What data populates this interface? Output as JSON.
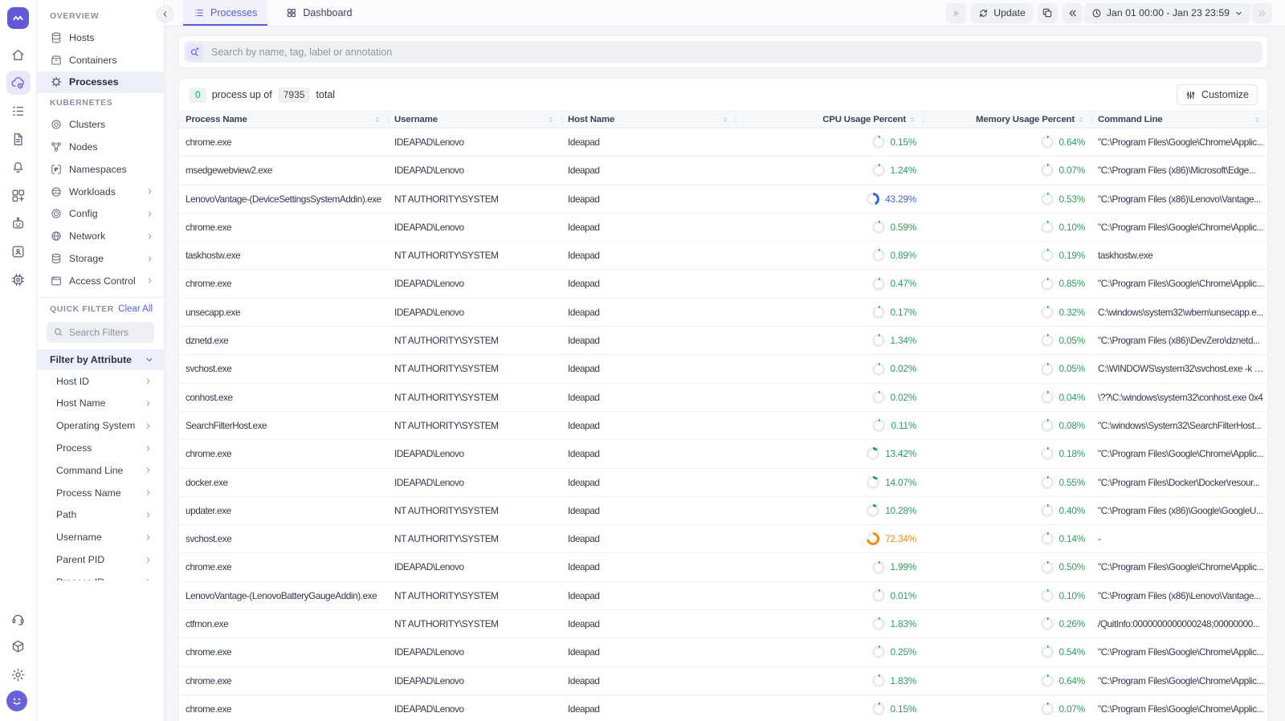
{
  "colors": {
    "green": "#26a35a",
    "blue": "#3e63dd",
    "orange": "#ef8e0d",
    "accent": "#5b5bd6",
    "track": "#e9ebee"
  },
  "rail": {
    "items": [
      "home",
      "infrastructure",
      "logs",
      "documents",
      "alerts",
      "dashboards",
      "bot",
      "rum",
      "integrations"
    ],
    "active": "infrastructure",
    "bottom": [
      "headset",
      "package",
      "gear"
    ],
    "avatar": "user-avatar"
  },
  "sidebar": {
    "sections": [
      {
        "title": "OVERVIEW",
        "items": [
          {
            "label": "Hosts",
            "icon": "hosts"
          },
          {
            "label": "Containers",
            "icon": "containers"
          },
          {
            "label": "Processes",
            "icon": "processes",
            "active": true
          }
        ]
      },
      {
        "title": "KUBERNETES",
        "items": [
          {
            "label": "Clusters",
            "icon": "clusters"
          },
          {
            "label": "Nodes",
            "icon": "nodes"
          },
          {
            "label": "Namespaces",
            "icon": "namespaces"
          },
          {
            "label": "Workloads",
            "icon": "workloads",
            "expandable": true
          },
          {
            "label": "Config",
            "icon": "config",
            "expandable": true
          },
          {
            "label": "Network",
            "icon": "network",
            "expandable": true
          },
          {
            "label": "Storage",
            "icon": "storage",
            "expandable": true
          },
          {
            "label": "Access Control",
            "icon": "access",
            "expandable": true
          }
        ]
      }
    ],
    "quick_filter": {
      "title": "QUICK FILTER",
      "clear_label": "Clear All",
      "search_placeholder": "Search Filters",
      "group_label": "Filter by Attribute",
      "attributes": [
        "Host ID",
        "Host Name",
        "Operating System",
        "Process",
        "Command Line",
        "Process Name",
        "Path",
        "Username",
        "Parent PID",
        "Process ID"
      ]
    }
  },
  "topbar": {
    "tabs": [
      {
        "label": "Processes",
        "icon": "list",
        "active": true
      },
      {
        "label": "Dashboard",
        "icon": "grid"
      }
    ],
    "update_label": "Update",
    "time_range": "Jan 01 00:00 - Jan 23 23:59"
  },
  "search": {
    "placeholder": "Search by name, tag, label or annotation"
  },
  "status": {
    "up_count": "0",
    "label_mid": "process up of",
    "total": "7935",
    "label_end": "total",
    "customize_label": "Customize"
  },
  "table": {
    "columns": [
      "Process Name",
      "Username",
      "Host Name",
      "CPU Usage Percent",
      "Memory Usage Percent",
      "Command Line"
    ],
    "rows": [
      {
        "process": "chrome.exe",
        "username": "IDEAPAD\\Lenovo",
        "host": "Ideapad",
        "cpu": 0.15,
        "cpu_label": "0.15%",
        "mem": 0.64,
        "mem_label": "0.64%",
        "command": "\"C:\\Program Files\\Google\\Chrome\\Applic..."
      },
      {
        "process": "msedgewebview2.exe",
        "username": "IDEAPAD\\Lenovo",
        "host": "Ideapad",
        "cpu": 1.24,
        "cpu_label": "1.24%",
        "mem": 0.07,
        "mem_label": "0.07%",
        "command": "\"C:\\Program Files (x86)\\Microsoft\\Edge..."
      },
      {
        "process": "LenovoVantage-(DeviceSettingsSystemAddin).exe",
        "username": "NT AUTHORITY\\SYSTEM",
        "host": "Ideapad",
        "cpu": 43.29,
        "cpu_label": "43.29%",
        "mem": 0.53,
        "mem_label": "0.53%",
        "command": "\"C:\\Program Files (x86)\\Lenovo\\Vantage..."
      },
      {
        "process": "chrome.exe",
        "username": "IDEAPAD\\Lenovo",
        "host": "Ideapad",
        "cpu": 0.59,
        "cpu_label": "0.59%",
        "mem": 0.1,
        "mem_label": "0.10%",
        "command": "\"C:\\Program Files\\Google\\Chrome\\Applic..."
      },
      {
        "process": "taskhostw.exe",
        "username": "NT AUTHORITY\\SYSTEM",
        "host": "Ideapad",
        "cpu": 0.89,
        "cpu_label": "0.89%",
        "mem": 0.19,
        "mem_label": "0.19%",
        "command": "taskhostw.exe"
      },
      {
        "process": "chrome.exe",
        "username": "IDEAPAD\\Lenovo",
        "host": "Ideapad",
        "cpu": 0.47,
        "cpu_label": "0.47%",
        "mem": 0.85,
        "mem_label": "0.85%",
        "command": "\"C:\\Program Files\\Google\\Chrome\\Applic..."
      },
      {
        "process": "unsecapp.exe",
        "username": "IDEAPAD\\Lenovo",
        "host": "Ideapad",
        "cpu": 0.17,
        "cpu_label": "0.17%",
        "mem": 0.32,
        "mem_label": "0.32%",
        "command": "C:\\windows\\system32\\wbem\\unsecapp.e..."
      },
      {
        "process": "dznetd.exe",
        "username": "NT AUTHORITY\\SYSTEM",
        "host": "Ideapad",
        "cpu": 1.34,
        "cpu_label": "1.34%",
        "mem": 0.05,
        "mem_label": "0.05%",
        "command": "\"C:\\Program Files (x86)\\DevZero\\dznetd..."
      },
      {
        "process": "svchost.exe",
        "username": "NT AUTHORITY\\SYSTEM",
        "host": "Ideapad",
        "cpu": 0.02,
        "cpu_label": "0.02%",
        "mem": 0.05,
        "mem_label": "0.05%",
        "command": "C:\\WINDOWS\\system32\\svchost.exe -k n..."
      },
      {
        "process": "conhost.exe",
        "username": "NT AUTHORITY\\SYSTEM",
        "host": "Ideapad",
        "cpu": 0.02,
        "cpu_label": "0.02%",
        "mem": 0.04,
        "mem_label": "0.04%",
        "command": "\\??\\C:\\windows\\system32\\conhost.exe 0x4"
      },
      {
        "process": "SearchFilterHost.exe",
        "username": "NT AUTHORITY\\SYSTEM",
        "host": "Ideapad",
        "cpu": 0.11,
        "cpu_label": "0.11%",
        "mem": 0.08,
        "mem_label": "0.08%",
        "command": "\"C:\\windows\\System32\\SearchFilterHost..."
      },
      {
        "process": "chrome.exe",
        "username": "IDEAPAD\\Lenovo",
        "host": "Ideapad",
        "cpu": 13.42,
        "cpu_label": "13.42%",
        "mem": 0.18,
        "mem_label": "0.18%",
        "command": "\"C:\\Program Files\\Google\\Chrome\\Applic..."
      },
      {
        "process": "docker.exe",
        "username": "IDEAPAD\\Lenovo",
        "host": "Ideapad",
        "cpu": 14.07,
        "cpu_label": "14.07%",
        "mem": 0.55,
        "mem_label": "0.55%",
        "command": "\"C:\\Program Files\\Docker\\Docker\\resour..."
      },
      {
        "process": "updater.exe",
        "username": "NT AUTHORITY\\SYSTEM",
        "host": "Ideapad",
        "cpu": 10.28,
        "cpu_label": "10.28%",
        "mem": 0.4,
        "mem_label": "0.40%",
        "command": "\"C:\\Program Files (x86)\\Google\\GoogleU..."
      },
      {
        "process": "svchost.exe",
        "username": "NT AUTHORITY\\SYSTEM",
        "host": "Ideapad",
        "cpu": 72.34,
        "cpu_label": "72.34%",
        "mem": 0.14,
        "mem_label": "0.14%",
        "command": "-"
      },
      {
        "process": "chrome.exe",
        "username": "IDEAPAD\\Lenovo",
        "host": "Ideapad",
        "cpu": 1.99,
        "cpu_label": "1.99%",
        "mem": 0.5,
        "mem_label": "0.50%",
        "command": "\"C:\\Program Files\\Google\\Chrome\\Applic..."
      },
      {
        "process": "LenovoVantage-(LenovoBatteryGaugeAddin).exe",
        "username": "NT AUTHORITY\\SYSTEM",
        "host": "Ideapad",
        "cpu": 0.01,
        "cpu_label": "0.01%",
        "mem": 0.1,
        "mem_label": "0.10%",
        "command": "\"C:\\Program Files (x86)\\Lenovo\\Vantage..."
      },
      {
        "process": "ctfmon.exe",
        "username": "NT AUTHORITY\\SYSTEM",
        "host": "Ideapad",
        "cpu": 1.83,
        "cpu_label": "1.83%",
        "mem": 0.26,
        "mem_label": "0.26%",
        "command": "/QuitInfo:0000000000000248;00000000..."
      },
      {
        "process": "chrome.exe",
        "username": "IDEAPAD\\Lenovo",
        "host": "Ideapad",
        "cpu": 0.25,
        "cpu_label": "0.25%",
        "mem": 0.54,
        "mem_label": "0.54%",
        "command": "\"C:\\Program Files\\Google\\Chrome\\Applic..."
      },
      {
        "process": "chrome.exe",
        "username": "IDEAPAD\\Lenovo",
        "host": "Ideapad",
        "cpu": 1.83,
        "cpu_label": "1.83%",
        "mem": 0.64,
        "mem_label": "0.64%",
        "command": "\"C:\\Program Files\\Google\\Chrome\\Applic..."
      },
      {
        "process": "chrome.exe",
        "username": "IDEAPAD\\Lenovo",
        "host": "Ideapad",
        "cpu": 0.15,
        "cpu_label": "0.15%",
        "mem": 0.07,
        "mem_label": "0.07%",
        "command": "\"C:\\Program Files\\Google\\Chrome\\Applic..."
      }
    ]
  }
}
